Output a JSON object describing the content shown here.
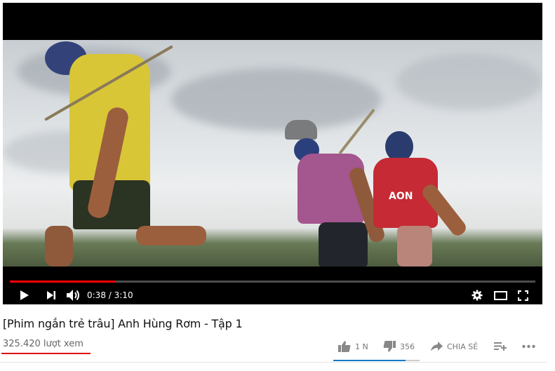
{
  "player": {
    "current_time": "0:38",
    "time_separator": " / ",
    "duration": "3:10",
    "progress_fraction": 0.2,
    "scene": {
      "shirt_logo_text": "AON"
    }
  },
  "video": {
    "title": "[Phim ngắn trẻ trâu] Anh Hùng Rơm - Tập 1",
    "views": "325.420 lượt xem"
  },
  "actions": {
    "like_count": "1 N",
    "dislike_count": "356",
    "share_label": "CHIA SẺ",
    "like_ratio": 0.84
  },
  "colors": {
    "progress": "#ff0000",
    "views_underline": "#dd1111",
    "like_bar": "#167ac6"
  },
  "icons": [
    "play-icon",
    "next-icon",
    "volume-icon",
    "settings-icon",
    "theater-mode-icon",
    "fullscreen-icon",
    "thumbs-up-icon",
    "thumbs-down-icon",
    "share-icon",
    "add-to-playlist-icon",
    "more-icon"
  ]
}
